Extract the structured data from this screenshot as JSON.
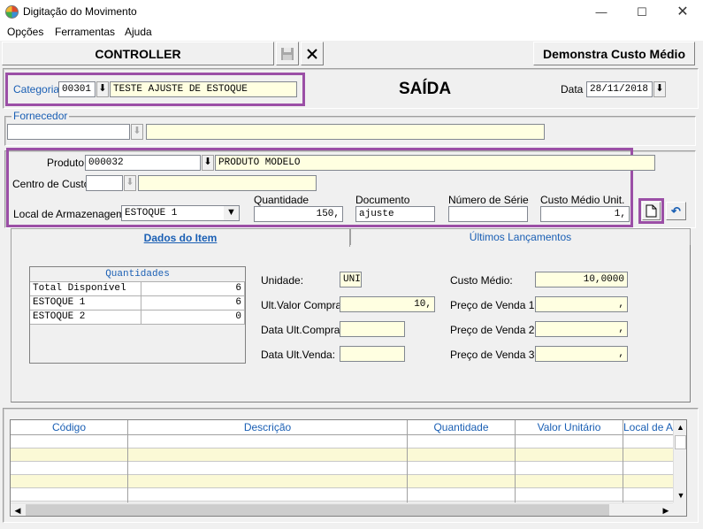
{
  "window": {
    "title": "Digitação do Movimento"
  },
  "menu": [
    "Opções",
    "Ferramentas",
    "Ajuda"
  ],
  "toolbar": {
    "controller_label": "CONTROLLER",
    "demo_cost_label": "Demonstra Custo Médio"
  },
  "header": {
    "categoria_label": "Categoria",
    "categoria_code": "00301",
    "categoria_desc": "TESTE AJUSTE DE ESTOQUE",
    "mode_title": "SAÍDA",
    "data_label": "Data",
    "data_value": "28/11/2018"
  },
  "fornecedor": {
    "label": "Fornecedor",
    "code": "",
    "desc": ""
  },
  "item": {
    "produto_label": "Produto",
    "produto_code": "000032",
    "produto_desc": "PRODUTO MODELO",
    "centro_label": "Centro de Custo",
    "centro_code": "",
    "centro_desc": "",
    "local_label": "Local de Armazenagem",
    "local_value": "ESTOQUE 1",
    "quantidade_label": "Quantidade",
    "quantidade_value": "150,",
    "documento_label": "Documento",
    "documento_value": "ajuste",
    "serie_label": "Número de Série",
    "serie_value": "",
    "custo_label": "Custo Médio Unit.",
    "custo_value": "1,"
  },
  "tabs": [
    "Dados do Item",
    "Últimos Lançamentos"
  ],
  "quantities": {
    "header": "Quantidades",
    "rows": [
      {
        "name": "Total Disponível",
        "value": "6"
      },
      {
        "name": "ESTOQUE 1",
        "value": "6"
      },
      {
        "name": "ESTOQUE 2",
        "value": "0"
      }
    ]
  },
  "details": {
    "unidade_label": "Unidade:",
    "unidade_value": "UNI",
    "ult_valor_label": "Ult.Valor Compra:",
    "ult_valor_value": "10,",
    "data_ult_compra_label": "Data Ult.Compra:",
    "data_ult_compra_value": "",
    "data_ult_venda_label": "Data Ult.Venda:",
    "data_ult_venda_value": "",
    "custo_medio_label": "Custo Médio:",
    "custo_medio_value": "10,0000",
    "preco1_label": "Preço de Venda 1:",
    "preco1_value": ",",
    "preco2_label": "Preço de Venda 2:",
    "preco2_value": ",",
    "preco3_label": "Preço de Venda 3:",
    "preco3_value": ","
  },
  "grid": {
    "columns": [
      "Código",
      "Descrição",
      "Quantidade",
      "Valor Unitário",
      "Local de A"
    ]
  }
}
